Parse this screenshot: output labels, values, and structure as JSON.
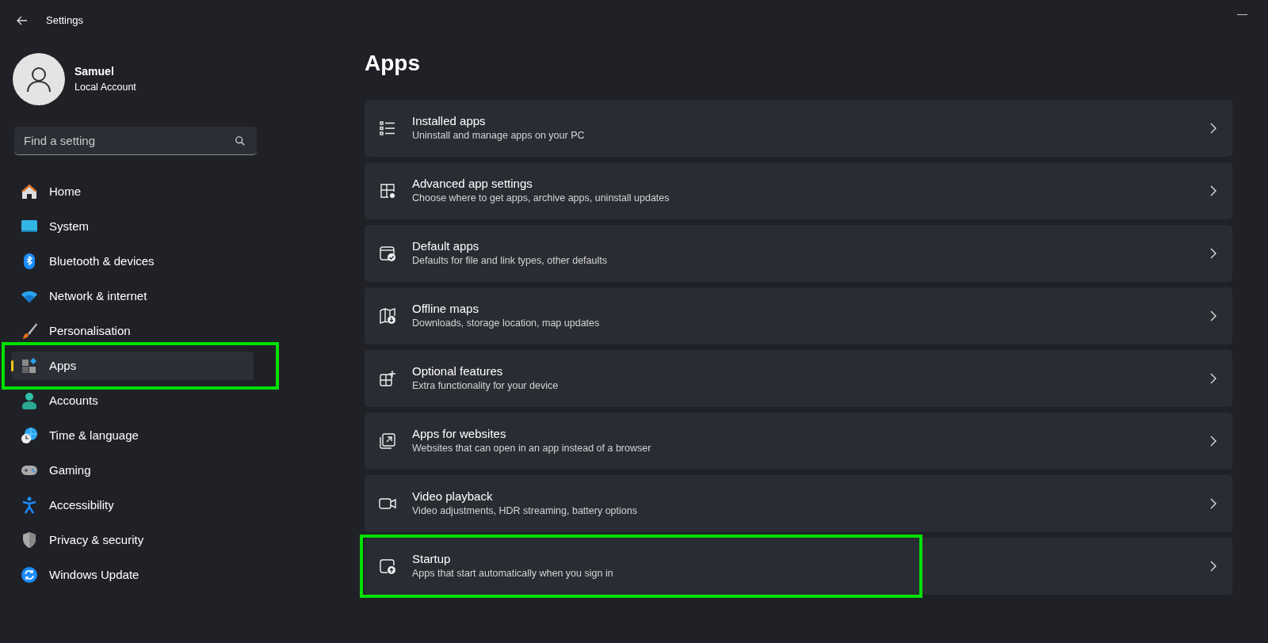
{
  "window": {
    "title": "Settings",
    "minimize": "—"
  },
  "account": {
    "name": "Samuel",
    "type": "Local Account"
  },
  "search": {
    "placeholder": "Find a setting"
  },
  "sidebar": {
    "items": [
      {
        "label": "Home",
        "selected": false,
        "highlighted": false
      },
      {
        "label": "System",
        "selected": false,
        "highlighted": false
      },
      {
        "label": "Bluetooth & devices",
        "selected": false,
        "highlighted": false
      },
      {
        "label": "Network & internet",
        "selected": false,
        "highlighted": false
      },
      {
        "label": "Personalisation",
        "selected": false,
        "highlighted": false
      },
      {
        "label": "Apps",
        "selected": true,
        "highlighted": true
      },
      {
        "label": "Accounts",
        "selected": false,
        "highlighted": false
      },
      {
        "label": "Time & language",
        "selected": false,
        "highlighted": false
      },
      {
        "label": "Gaming",
        "selected": false,
        "highlighted": false
      },
      {
        "label": "Accessibility",
        "selected": false,
        "highlighted": false
      },
      {
        "label": "Privacy & security",
        "selected": false,
        "highlighted": false
      },
      {
        "label": "Windows Update",
        "selected": false,
        "highlighted": false
      }
    ]
  },
  "page": {
    "title": "Apps",
    "items": [
      {
        "title": "Installed apps",
        "subtitle": "Uninstall and manage apps on your PC",
        "highlighted": false
      },
      {
        "title": "Advanced app settings",
        "subtitle": "Choose where to get apps, archive apps, uninstall updates",
        "highlighted": false
      },
      {
        "title": "Default apps",
        "subtitle": "Defaults for file and link types, other defaults",
        "highlighted": false
      },
      {
        "title": "Offline maps",
        "subtitle": "Downloads, storage location, map updates",
        "highlighted": false
      },
      {
        "title": "Optional features",
        "subtitle": "Extra functionality for your device",
        "highlighted": false
      },
      {
        "title": "Apps for websites",
        "subtitle": "Websites that can open in an app instead of a browser",
        "highlighted": false
      },
      {
        "title": "Video playback",
        "subtitle": "Video adjustments, HDR streaming, battery options",
        "highlighted": false
      },
      {
        "title": "Startup",
        "subtitle": "Apps that start automatically when you sign in",
        "highlighted": true
      }
    ]
  }
}
